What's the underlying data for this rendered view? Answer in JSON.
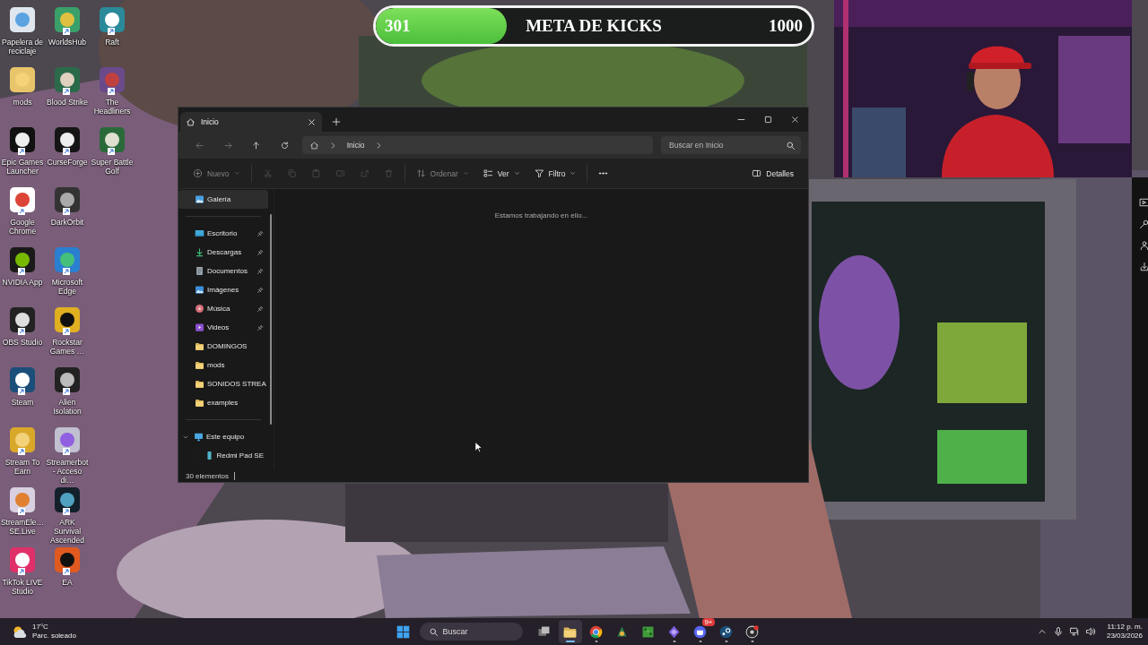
{
  "goal_bar": {
    "current": "301",
    "title": "META DE KICKS",
    "target": "1000",
    "level": 0.301
  },
  "desktop_icons": [
    {
      "label": "Papelera de reciclaje",
      "shortcut": false
    },
    {
      "label": "mods",
      "shortcut": false
    },
    {
      "label": "Epic Games Launcher",
      "shortcut": true
    },
    {
      "label": "Google Chrome",
      "shortcut": true
    },
    {
      "label": "NVIDIA App",
      "shortcut": true
    },
    {
      "label": "OBS Studio",
      "shortcut": true
    },
    {
      "label": "Steam",
      "shortcut": true
    },
    {
      "label": "Stream To Earn",
      "shortcut": true
    },
    {
      "label": "StreamEle… SE.Live",
      "shortcut": true
    },
    {
      "label": "TikTok LIVE Studio",
      "shortcut": true
    },
    {
      "label": "WorldsHub",
      "shortcut": true
    },
    {
      "label": "Blood Strike",
      "shortcut": true
    },
    {
      "label": "CurseForge",
      "shortcut": true
    },
    {
      "label": "DarkOrbit",
      "shortcut": true
    },
    {
      "label": "Microsoft Edge",
      "shortcut": true
    },
    {
      "label": "Rockstar Games …",
      "shortcut": true
    },
    {
      "label": "Alien Isolation",
      "shortcut": true
    },
    {
      "label": "Streamerbot - Acceso di…",
      "shortcut": true
    },
    {
      "label": "ARK Survival Ascended",
      "shortcut": true
    },
    {
      "label": "EA",
      "shortcut": true
    },
    {
      "label": "Raft",
      "shortcut": true
    },
    {
      "label": "The Headliners",
      "shortcut": true
    },
    {
      "label": "Super Battle Golf",
      "shortcut": true
    }
  ],
  "explorer": {
    "tab": {
      "title": "Inicio"
    },
    "nav": [
      {
        "kind": "back",
        "disabled": true
      },
      {
        "kind": "forward",
        "disabled": true
      },
      {
        "kind": "up",
        "disabled": false
      },
      {
        "kind": "refresh",
        "disabled": false
      }
    ],
    "breadcrumb": [
      "Inicio"
    ],
    "search": {
      "placeholder": "Buscar en Inicio"
    },
    "toolbar": [
      {
        "kind": "new",
        "label": "Nuevo",
        "disabled": true,
        "menu": true
      },
      {
        "kind": "separator"
      },
      {
        "kind": "cut",
        "disabled": true,
        "menu": false
      },
      {
        "kind": "copy",
        "disabled": true,
        "menu": false
      },
      {
        "kind": "paste",
        "disabled": true,
        "menu": false
      },
      {
        "kind": "rename",
        "disabled": true,
        "menu": false
      },
      {
        "kind": "share",
        "disabled": true,
        "menu": false
      },
      {
        "kind": "delete",
        "disabled": true,
        "menu": false
      },
      {
        "kind": "separator"
      },
      {
        "kind": "sort",
        "label": "Ordenar",
        "disabled": true,
        "menu": true
      },
      {
        "kind": "view",
        "label": "Ver",
        "disabled": false,
        "menu": true
      },
      {
        "kind": "filter",
        "label": "Filtro",
        "disabled": false,
        "menu": true
      },
      {
        "kind": "separator"
      },
      {
        "kind": "more",
        "disabled": false,
        "menu": false
      }
    ],
    "details": {
      "label": "Detalles"
    },
    "sidebar": [
      [
        {
          "label": "Galería",
          "kind": "gallery",
          "selected": true,
          "pinned": false
        }
      ],
      [
        {
          "label": "Escritorio",
          "kind": "desktop",
          "selected": false,
          "pinned": true
        },
        {
          "label": "Descargas",
          "kind": "download",
          "selected": false,
          "pinned": true
        },
        {
          "label": "Documentos",
          "kind": "documents",
          "selected": false,
          "pinned": true
        },
        {
          "label": "Imágenes",
          "kind": "images",
          "selected": false,
          "pinned": true
        },
        {
          "label": "Música",
          "kind": "music",
          "selected": false,
          "pinned": true
        },
        {
          "label": "Videos",
          "kind": "videos",
          "selected": false,
          "pinned": true
        },
        {
          "label": "DOMINGOS",
          "kind": "folder",
          "selected": false,
          "pinned": false
        },
        {
          "label": "mods",
          "kind": "folder",
          "selected": false,
          "pinned": false
        },
        {
          "label": "SONIDOS STREA",
          "kind": "folder",
          "selected": false,
          "pinned": false
        },
        {
          "label": "examples",
          "kind": "folder",
          "selected": false,
          "pinned": false
        }
      ],
      [
        {
          "label": "Este equipo",
          "kind": "pc",
          "selected": false,
          "expanded": true,
          "children": [
            {
              "label": "Redmi Pad SE",
              "kind": "device",
              "selected": false,
              "expanded": false
            }
          ]
        }
      ]
    ],
    "message": "Estamos trabajando en ello...",
    "status": "30 elementos"
  },
  "taskbar": {
    "weather": {
      "temperature": "17°C",
      "condition": "Parc. soleado"
    },
    "search": {
      "placeholder": "Buscar"
    },
    "apps": [
      {
        "kind": "taskview",
        "running": false,
        "active": false
      },
      {
        "kind": "explorer",
        "running": true,
        "active": true
      },
      {
        "kind": "chrome",
        "running": true,
        "active": false
      },
      {
        "kind": "app",
        "running": false,
        "active": false
      },
      {
        "kind": "blocks",
        "running": false,
        "active": false
      },
      {
        "kind": "diamond",
        "running": true,
        "active": false
      },
      {
        "kind": "discord",
        "running": true,
        "active": false,
        "badge": "9+"
      },
      {
        "kind": "steam",
        "running": true,
        "active": false
      },
      {
        "kind": "recorder",
        "running": true,
        "active": false
      }
    ],
    "tray": [
      {
        "kind": "chevup"
      },
      {
        "kind": "mic"
      },
      {
        "kind": "network"
      },
      {
        "kind": "speaker"
      }
    ],
    "time": "11:12 p. m.",
    "date": "23/03/2026"
  }
}
